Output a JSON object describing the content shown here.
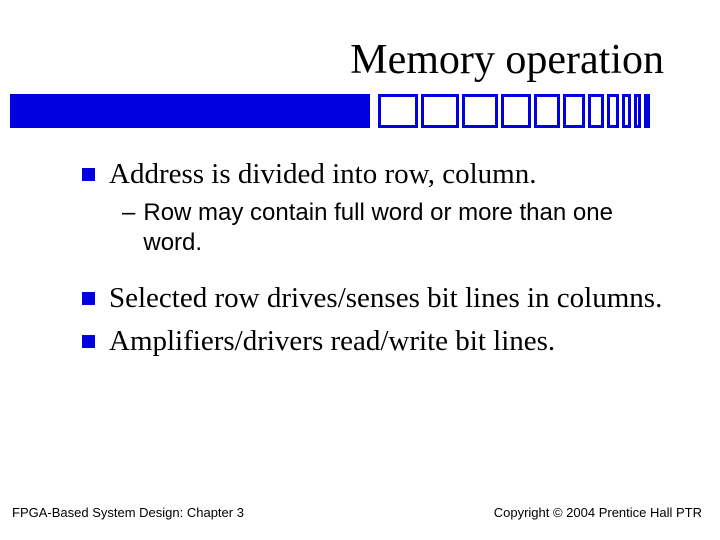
{
  "title": "Memory operation",
  "bullets": {
    "b0": "Address is divided into row, column.",
    "b0_sub": "Row may contain full word or more than one word.",
    "b1": "Selected row drives/senses bit lines in columns.",
    "b2": "Amplifiers/drivers read/write bit lines."
  },
  "footer": {
    "left": "FPGA-Based System Design: Chapter 3",
    "right": "Copyright © 2004  Prentice Hall PTR"
  }
}
